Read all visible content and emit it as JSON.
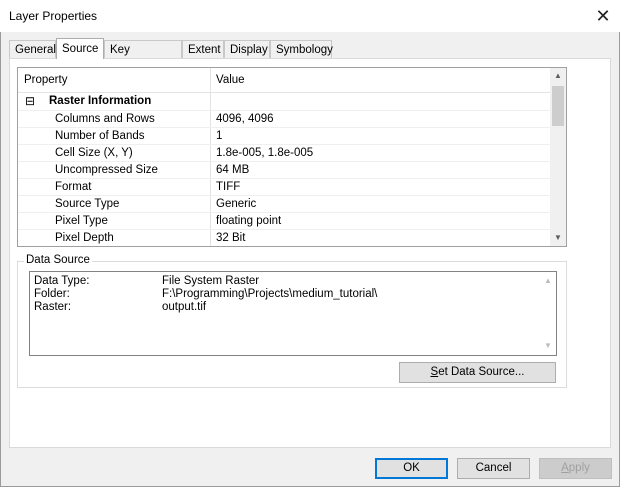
{
  "window": {
    "title": "Layer Properties"
  },
  "tabs": [
    {
      "label": "General"
    },
    {
      "label": "Source"
    },
    {
      "label": "Key Metadata"
    },
    {
      "label": "Extent"
    },
    {
      "label": "Display"
    },
    {
      "label": "Symbology"
    }
  ],
  "active_tab": "Source",
  "grid": {
    "headers": {
      "property": "Property",
      "value": "Value"
    },
    "section_title": "Raster Information",
    "collapse_symbol": "⊟",
    "rows": [
      {
        "property": "Columns and Rows",
        "value": "4096, 4096"
      },
      {
        "property": "Number of Bands",
        "value": "1"
      },
      {
        "property": "Cell Size (X, Y)",
        "value": "1.8e-005, 1.8e-005"
      },
      {
        "property": "Uncompressed Size",
        "value": "64 MB"
      },
      {
        "property": "Format",
        "value": "TIFF"
      },
      {
        "property": "Source Type",
        "value": "Generic"
      },
      {
        "property": "Pixel Type",
        "value": "floating point"
      },
      {
        "property": "Pixel Depth",
        "value": "32 Bit"
      }
    ]
  },
  "data_source": {
    "group_label": "Data Source",
    "lines": [
      {
        "label": "Data Type:",
        "value": "File System Raster"
      },
      {
        "label": "Folder:",
        "value": "F:\\Programming\\Projects\\medium_tutorial\\"
      },
      {
        "label": "Raster:",
        "value": "output.tif"
      }
    ],
    "set_button": {
      "accel": "S",
      "rest": "et Data Source..."
    }
  },
  "footer": {
    "ok": "OK",
    "cancel": "Cancel",
    "apply": {
      "accel": "A",
      "rest": "pply"
    }
  }
}
